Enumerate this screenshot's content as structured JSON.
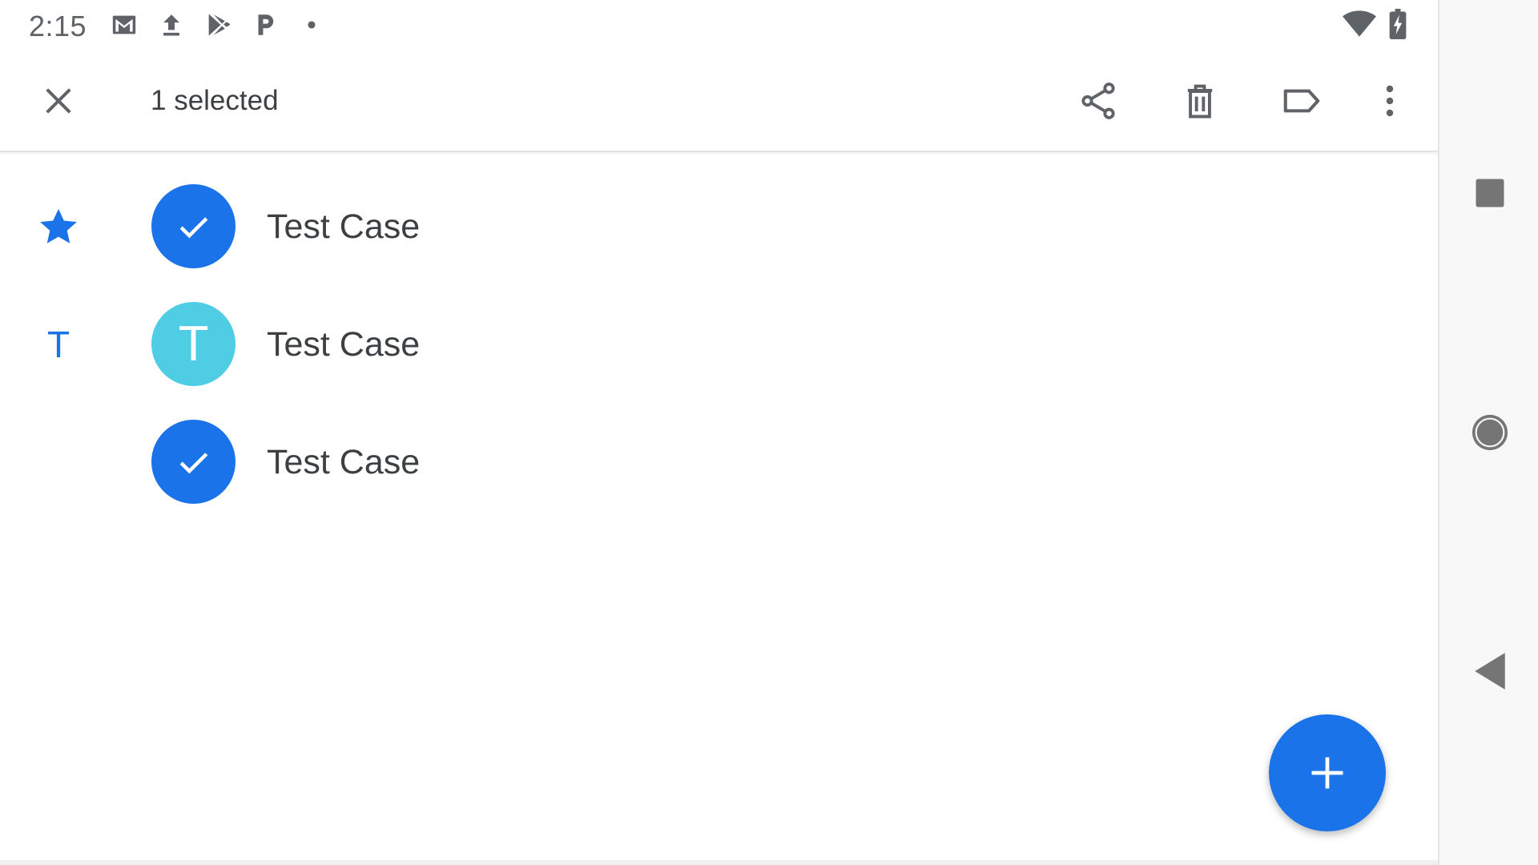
{
  "status_bar": {
    "time": "2:15",
    "icons": [
      "gmail-icon",
      "upload-icon",
      "play-store-icon",
      "parking-icon",
      "dot-icon",
      "wifi-icon",
      "battery-charging-icon"
    ]
  },
  "app_bar": {
    "close_icon": "close-icon",
    "selection_label": "1 selected",
    "actions": [
      "share-icon",
      "delete-icon",
      "label-icon",
      "more-vert-icon"
    ]
  },
  "contacts": [
    {
      "section": "star",
      "name": "Test Case",
      "avatar_state": "selected",
      "avatar_letter": ""
    },
    {
      "section": "T",
      "name": "Test Case",
      "avatar_state": "letter",
      "avatar_letter": "T"
    },
    {
      "section": "",
      "name": "Test Case",
      "avatar_state": "selected",
      "avatar_letter": ""
    }
  ],
  "fab": {
    "icon": "plus-icon"
  },
  "navigation": [
    "recents-square-icon",
    "home-circle-icon",
    "back-triangle-icon"
  ],
  "colors": {
    "accent": "#1a73e8",
    "letter_avatar": "#4ecde4",
    "text": "#3c4043",
    "icon": "#5f6368"
  }
}
